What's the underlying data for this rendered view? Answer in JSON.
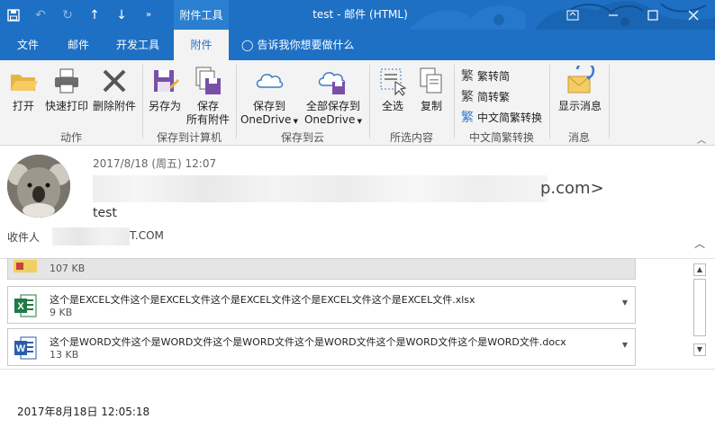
{
  "window": {
    "title": "test  -  邮件 (HTML)",
    "context_tab": "附件工具",
    "controls": [
      "minimize-icon",
      "maximize-icon",
      "close-icon"
    ]
  },
  "quick_access": {
    "icons": [
      "save-icon",
      "undo-icon",
      "redo-icon",
      "up-arrow-icon",
      "down-arrow-icon",
      "more-icon"
    ]
  },
  "tabs": {
    "file": "文件",
    "mail": "邮件",
    "developer": "开发工具",
    "attachments": "附件",
    "tell_me": "告诉我你想要做什么"
  },
  "ribbon": {
    "actions": {
      "label": "动作",
      "open": "打开",
      "quick_print": "快速打印",
      "remove": "删除附件"
    },
    "save_computer": {
      "label": "保存到计算机",
      "save_as": "另存为",
      "save_all_line1": "保存",
      "save_all_line2": "所有附件"
    },
    "save_cloud": {
      "label": "保存到云",
      "save_to_line1": "保存到",
      "save_to_line2": "OneDrive",
      "save_all_line1": "全部保存到",
      "save_all_line2": "OneDrive"
    },
    "selection": {
      "label": "所选内容",
      "select_all": "全选",
      "copy": "复制"
    },
    "chinese": {
      "label": "中文简繁转换",
      "to_simplified": "繁转简",
      "to_traditional": "简转繁",
      "conversion": "中文简繁转换"
    },
    "message": {
      "label": "消息",
      "show_message": "显示消息"
    }
  },
  "message": {
    "date": "2017/8/18 (周五) 12:07",
    "sender_visible_tail": "p.com>",
    "subject": "test",
    "to_label": "收件人",
    "to_visible_tail": "T.COM"
  },
  "attachments": [
    {
      "name": "",
      "size": "107 KB",
      "type": "image"
    },
    {
      "name": "这个是EXCEL文件这个是EXCEL文件这个是EXCEL文件这个是EXCEL文件这个是EXCEL文件.xlsx",
      "size": "9 KB",
      "type": "excel"
    },
    {
      "name": "这个是WORD文件这个是WORD文件这个是WORD文件这个是WORD文件这个是WORD文件这个是WORD文件.docx",
      "size": "13 KB",
      "type": "word"
    }
  ],
  "body": {
    "text": "2017年8月18日 12:05:18"
  },
  "colors": {
    "accent": "#1e70c4",
    "ribbon_bg": "#f3f3f3",
    "excel": "#1f7a45",
    "word": "#2b5ea8"
  }
}
